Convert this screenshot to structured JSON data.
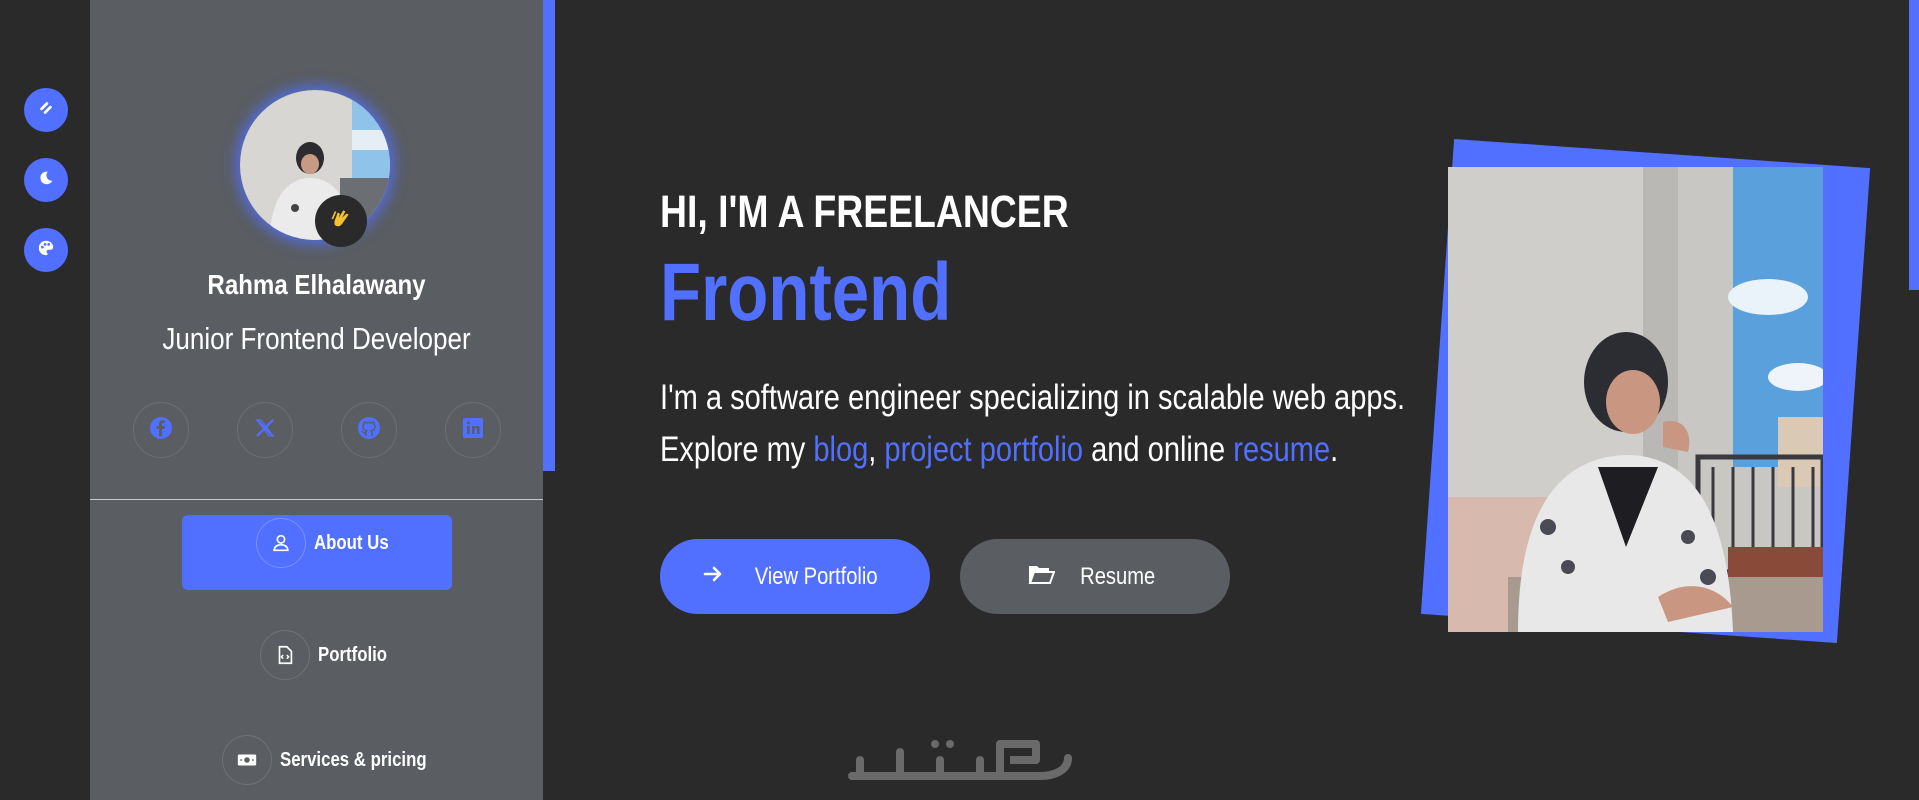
{
  "theme": {
    "accent": "#5170ff",
    "background": "#2a2a2a",
    "card": "#5a5d61"
  },
  "rail": {
    "buttons": [
      {
        "icon": "layout-toggle-icon"
      },
      {
        "icon": "moon-icon"
      },
      {
        "icon": "palette-icon"
      }
    ]
  },
  "profile": {
    "name": "Rahma Elhalawany",
    "role": "Junior Frontend Developer",
    "badge_icon": "clapping-hands-icon",
    "social": [
      "facebook-icon",
      "x-twitter-icon",
      "github-icon",
      "linkedin-icon"
    ]
  },
  "nav": {
    "items": [
      {
        "label": "About Us",
        "icon": "user-icon",
        "active": true
      },
      {
        "label": "Portfolio",
        "icon": "code-file-icon",
        "active": false
      },
      {
        "label": "Services & pricing",
        "icon": "money-icon",
        "active": false
      }
    ]
  },
  "hero": {
    "subtitle": "HI, I'M A FREELANCER",
    "title": "Frontend",
    "line1": "I'm a software engineer specializing in scalable web apps.",
    "line2_a": "Explore my ",
    "link_blog": "blog",
    "sep": ", ",
    "link_portfolio": "project portfolio",
    "line2_b": " and online ",
    "link_resume": "resume",
    "line2_end": ".",
    "btn_portfolio": "View Portfolio",
    "btn_resume": "Resume"
  }
}
